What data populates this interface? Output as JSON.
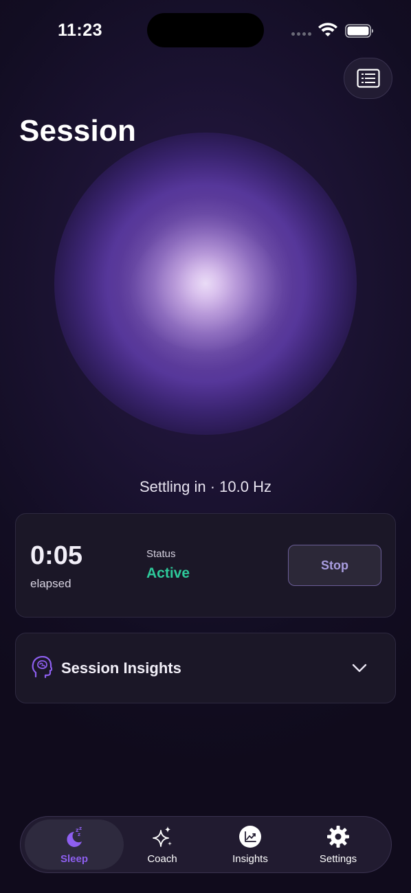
{
  "status_bar": {
    "time": "11:23"
  },
  "header": {
    "title": "Session"
  },
  "orb": {
    "phase_text": "Settling in · 10.0 Hz"
  },
  "session_card": {
    "elapsed_value": "0:05",
    "elapsed_label": "elapsed",
    "status_label": "Status",
    "status_value": "Active",
    "stop_label": "Stop"
  },
  "insights_card": {
    "title": "Session Insights"
  },
  "tabs": [
    {
      "label": "Sleep",
      "icon": "moon-zzz-icon",
      "active": true
    },
    {
      "label": "Coach",
      "icon": "sparkles-icon",
      "active": false
    },
    {
      "label": "Insights",
      "icon": "chart-icon",
      "active": false
    },
    {
      "label": "Settings",
      "icon": "gear-icon",
      "active": false
    }
  ],
  "colors": {
    "accent": "#8e5ff0",
    "status_active": "#2ec99a",
    "card_bg": "#1b1727",
    "stop_text": "#a99de0"
  }
}
